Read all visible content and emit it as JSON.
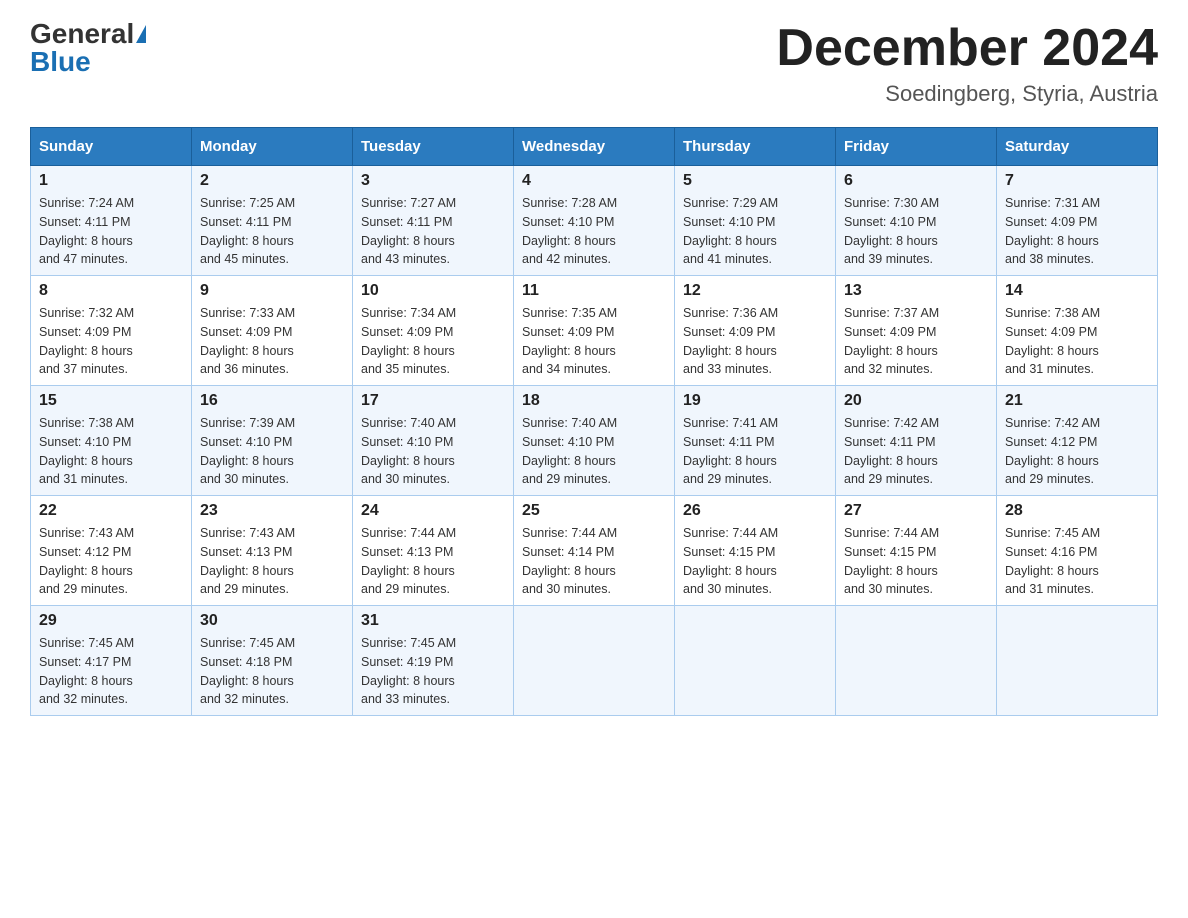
{
  "header": {
    "logo_general": "General",
    "logo_blue": "Blue",
    "month_title": "December 2024",
    "location": "Soedingberg, Styria, Austria"
  },
  "days_of_week": [
    "Sunday",
    "Monday",
    "Tuesday",
    "Wednesday",
    "Thursday",
    "Friday",
    "Saturday"
  ],
  "weeks": [
    [
      {
        "day": "1",
        "sunrise": "7:24 AM",
        "sunset": "4:11 PM",
        "daylight": "8 hours and 47 minutes."
      },
      {
        "day": "2",
        "sunrise": "7:25 AM",
        "sunset": "4:11 PM",
        "daylight": "8 hours and 45 minutes."
      },
      {
        "day": "3",
        "sunrise": "7:27 AM",
        "sunset": "4:11 PM",
        "daylight": "8 hours and 43 minutes."
      },
      {
        "day": "4",
        "sunrise": "7:28 AM",
        "sunset": "4:10 PM",
        "daylight": "8 hours and 42 minutes."
      },
      {
        "day": "5",
        "sunrise": "7:29 AM",
        "sunset": "4:10 PM",
        "daylight": "8 hours and 41 minutes."
      },
      {
        "day": "6",
        "sunrise": "7:30 AM",
        "sunset": "4:10 PM",
        "daylight": "8 hours and 39 minutes."
      },
      {
        "day": "7",
        "sunrise": "7:31 AM",
        "sunset": "4:09 PM",
        "daylight": "8 hours and 38 minutes."
      }
    ],
    [
      {
        "day": "8",
        "sunrise": "7:32 AM",
        "sunset": "4:09 PM",
        "daylight": "8 hours and 37 minutes."
      },
      {
        "day": "9",
        "sunrise": "7:33 AM",
        "sunset": "4:09 PM",
        "daylight": "8 hours and 36 minutes."
      },
      {
        "day": "10",
        "sunrise": "7:34 AM",
        "sunset": "4:09 PM",
        "daylight": "8 hours and 35 minutes."
      },
      {
        "day": "11",
        "sunrise": "7:35 AM",
        "sunset": "4:09 PM",
        "daylight": "8 hours and 34 minutes."
      },
      {
        "day": "12",
        "sunrise": "7:36 AM",
        "sunset": "4:09 PM",
        "daylight": "8 hours and 33 minutes."
      },
      {
        "day": "13",
        "sunrise": "7:37 AM",
        "sunset": "4:09 PM",
        "daylight": "8 hours and 32 minutes."
      },
      {
        "day": "14",
        "sunrise": "7:38 AM",
        "sunset": "4:09 PM",
        "daylight": "8 hours and 31 minutes."
      }
    ],
    [
      {
        "day": "15",
        "sunrise": "7:38 AM",
        "sunset": "4:10 PM",
        "daylight": "8 hours and 31 minutes."
      },
      {
        "day": "16",
        "sunrise": "7:39 AM",
        "sunset": "4:10 PM",
        "daylight": "8 hours and 30 minutes."
      },
      {
        "day": "17",
        "sunrise": "7:40 AM",
        "sunset": "4:10 PM",
        "daylight": "8 hours and 30 minutes."
      },
      {
        "day": "18",
        "sunrise": "7:40 AM",
        "sunset": "4:10 PM",
        "daylight": "8 hours and 29 minutes."
      },
      {
        "day": "19",
        "sunrise": "7:41 AM",
        "sunset": "4:11 PM",
        "daylight": "8 hours and 29 minutes."
      },
      {
        "day": "20",
        "sunrise": "7:42 AM",
        "sunset": "4:11 PM",
        "daylight": "8 hours and 29 minutes."
      },
      {
        "day": "21",
        "sunrise": "7:42 AM",
        "sunset": "4:12 PM",
        "daylight": "8 hours and 29 minutes."
      }
    ],
    [
      {
        "day": "22",
        "sunrise": "7:43 AM",
        "sunset": "4:12 PM",
        "daylight": "8 hours and 29 minutes."
      },
      {
        "day": "23",
        "sunrise": "7:43 AM",
        "sunset": "4:13 PM",
        "daylight": "8 hours and 29 minutes."
      },
      {
        "day": "24",
        "sunrise": "7:44 AM",
        "sunset": "4:13 PM",
        "daylight": "8 hours and 29 minutes."
      },
      {
        "day": "25",
        "sunrise": "7:44 AM",
        "sunset": "4:14 PM",
        "daylight": "8 hours and 30 minutes."
      },
      {
        "day": "26",
        "sunrise": "7:44 AM",
        "sunset": "4:15 PM",
        "daylight": "8 hours and 30 minutes."
      },
      {
        "day": "27",
        "sunrise": "7:44 AM",
        "sunset": "4:15 PM",
        "daylight": "8 hours and 30 minutes."
      },
      {
        "day": "28",
        "sunrise": "7:45 AM",
        "sunset": "4:16 PM",
        "daylight": "8 hours and 31 minutes."
      }
    ],
    [
      {
        "day": "29",
        "sunrise": "7:45 AM",
        "sunset": "4:17 PM",
        "daylight": "8 hours and 32 minutes."
      },
      {
        "day": "30",
        "sunrise": "7:45 AM",
        "sunset": "4:18 PM",
        "daylight": "8 hours and 32 minutes."
      },
      {
        "day": "31",
        "sunrise": "7:45 AM",
        "sunset": "4:19 PM",
        "daylight": "8 hours and 33 minutes."
      },
      null,
      null,
      null,
      null
    ]
  ],
  "labels": {
    "sunrise": "Sunrise:",
    "sunset": "Sunset:",
    "daylight": "Daylight:"
  }
}
